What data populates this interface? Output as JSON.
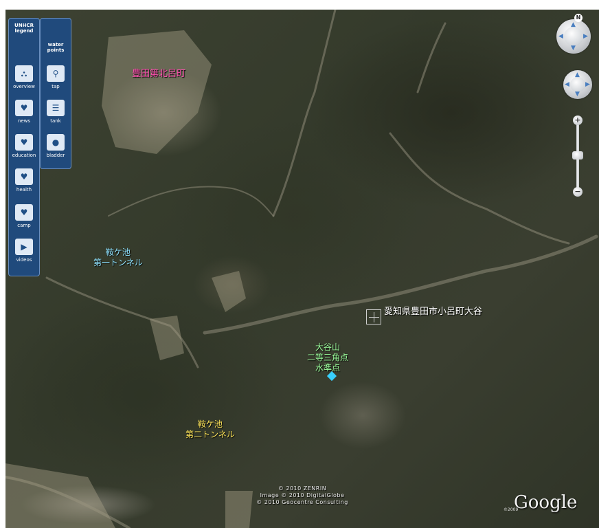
{
  "legend": {
    "title": "UNHCR\nlegend",
    "water_title": "water\npoints",
    "left_items": [
      {
        "label": "overview",
        "icon": "unhcr-logo-icon"
      },
      {
        "label": "news",
        "icon": "unhcr-hands-icon"
      },
      {
        "label": "education",
        "icon": "unhcr-hands-icon"
      },
      {
        "label": "health",
        "icon": "unhcr-hands-icon"
      },
      {
        "label": "camp",
        "icon": "unhcr-hands-icon"
      },
      {
        "label": "videos",
        "icon": "video-icon"
      }
    ],
    "right_items": [
      {
        "label": "tap",
        "icon": "tap-icon"
      },
      {
        "label": "tank",
        "icon": "tank-icon"
      },
      {
        "label": "bladder",
        "icon": "bladder-icon"
      }
    ]
  },
  "labels": {
    "town": "豊田第北呂町",
    "tunnel1_line1": "鞍ケ池",
    "tunnel1_line2": "第一トンネル",
    "tunnel2_line1": "鞍ケ池",
    "tunnel2_line2": "第二トンネル",
    "place": "愛知県豊田市小呂町大谷",
    "peak_line1": "大谷山",
    "peak_line2": "二等三角点",
    "peak_line3": "水準点"
  },
  "colors": {
    "town": "#ff4fb0",
    "tunnel1": "#8fe3ff",
    "tunnel2": "#ffe65a",
    "peak": "#9cff9c",
    "place": "#ffffff"
  },
  "navigation": {
    "compass_letter": "N",
    "zoom_plus": "+",
    "zoom_minus": "−"
  },
  "credits": {
    "line1": "© 2010 ZENRIN",
    "line2": "Image © 2010 DigitalGlobe",
    "line3": "© 2010 Geocentre Consulting",
    "logo": "Google",
    "logo_year": "©2009"
  }
}
